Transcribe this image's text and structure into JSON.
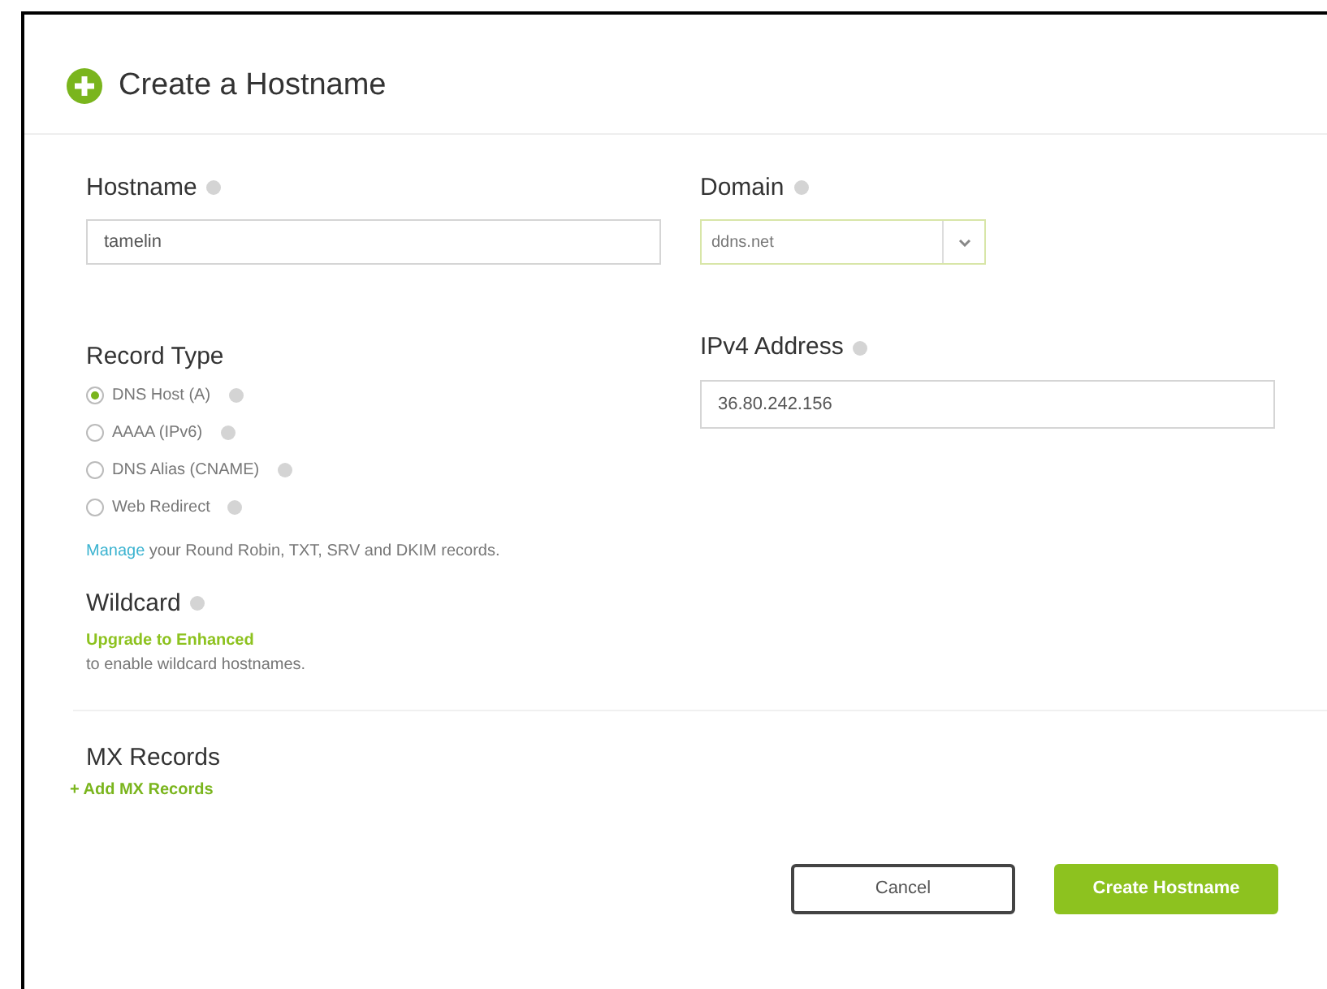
{
  "title": "Create a Hostname",
  "hostname": {
    "label": "Hostname",
    "value": "tamelin"
  },
  "domain": {
    "label": "Domain",
    "value": "ddns.net"
  },
  "record_type": {
    "label": "Record Type",
    "options": [
      {
        "label": "DNS Host (A)",
        "selected": true
      },
      {
        "label": "AAAA (IPv6)",
        "selected": false
      },
      {
        "label": "DNS Alias (CNAME)",
        "selected": false
      },
      {
        "label": "Web Redirect",
        "selected": false
      }
    ]
  },
  "manage_note": {
    "link": "Manage",
    "text": "your Round Robin, TXT, SRV and DKIM records."
  },
  "ipv4": {
    "label": "IPv4 Address",
    "value": "36.80.242.156"
  },
  "wildcard": {
    "label": "Wildcard",
    "link": "Upgrade to Enhanced",
    "note": "to enable wildcard hostnames."
  },
  "mx": {
    "label": "MX Records",
    "link": "+ Add MX Records"
  },
  "buttons": {
    "cancel": "Cancel",
    "create": "Create Hostname"
  }
}
